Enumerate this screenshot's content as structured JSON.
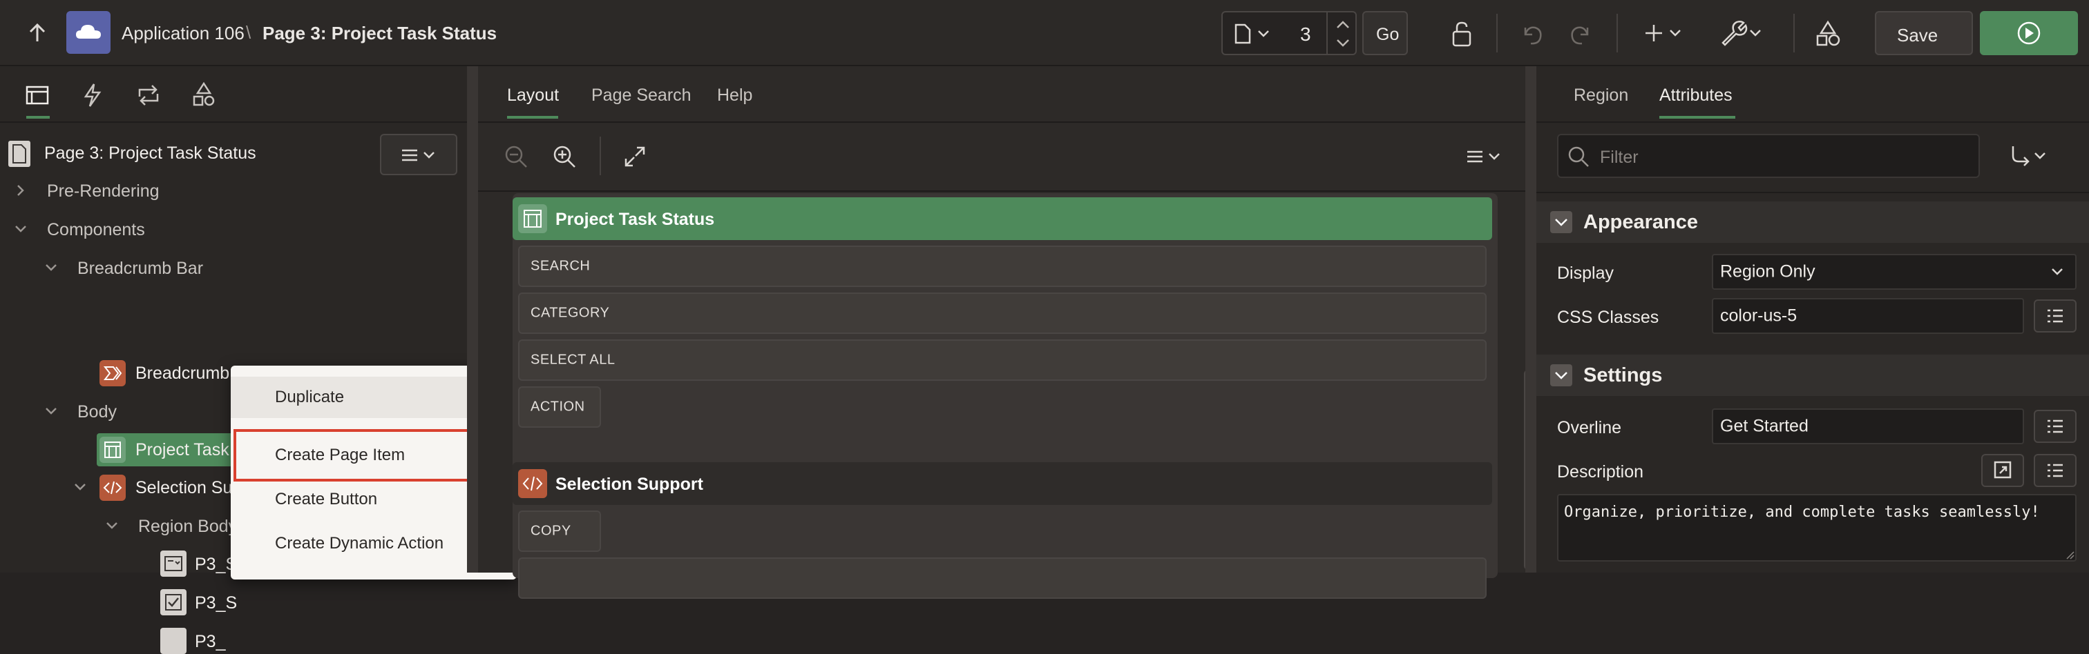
{
  "topbar": {
    "app_name": "Application 106",
    "separator": "\\",
    "page_title": "Page 3: Project Task Status",
    "page_number": "3",
    "go_label": "Go",
    "save_label": "Save"
  },
  "left": {
    "page_node": "Page 3: Project Task Status",
    "tree": {
      "pre_rendering": "Pre-Rendering",
      "components": "Components",
      "breadcrumb_bar": "Breadcrumb Bar",
      "breadcrumb": "Breadcrumb",
      "body": "Body",
      "project_task": "Project Task S",
      "selection_support": "Selection Sup",
      "region_body": "Region Body",
      "item1": "P3_S",
      "item2": "P3_S",
      "item3": "P3_"
    }
  },
  "context_menu": {
    "items": [
      "Duplicate",
      "Create Page Item",
      "Create Button",
      "Create Dynamic Action"
    ]
  },
  "center": {
    "tabs": [
      "Layout",
      "Page Search",
      "Help"
    ],
    "region1_title": "Project Task Status",
    "region1_items": [
      "SEARCH",
      "CATEGORY",
      "SELECT ALL"
    ],
    "region1_button": "ACTION",
    "region2_title": "Selection Support",
    "region2_button": "COPY"
  },
  "right": {
    "tabs": [
      "Region",
      "Attributes"
    ],
    "filter_placeholder": "Filter",
    "appearance_header": "Appearance",
    "display_label": "Display",
    "display_value": "Region Only",
    "css_label": "CSS Classes",
    "css_value": "color-us-5",
    "settings_header": "Settings",
    "overline_label": "Overline",
    "overline_value": "Get Started",
    "description_label": "Description",
    "description_value": "Organize, prioritize, and complete tasks seamlessly!"
  },
  "colors": {
    "accent_green": "#4e8a5b",
    "highlight_red": "#d9412f",
    "icon_orange": "#b5583a"
  }
}
